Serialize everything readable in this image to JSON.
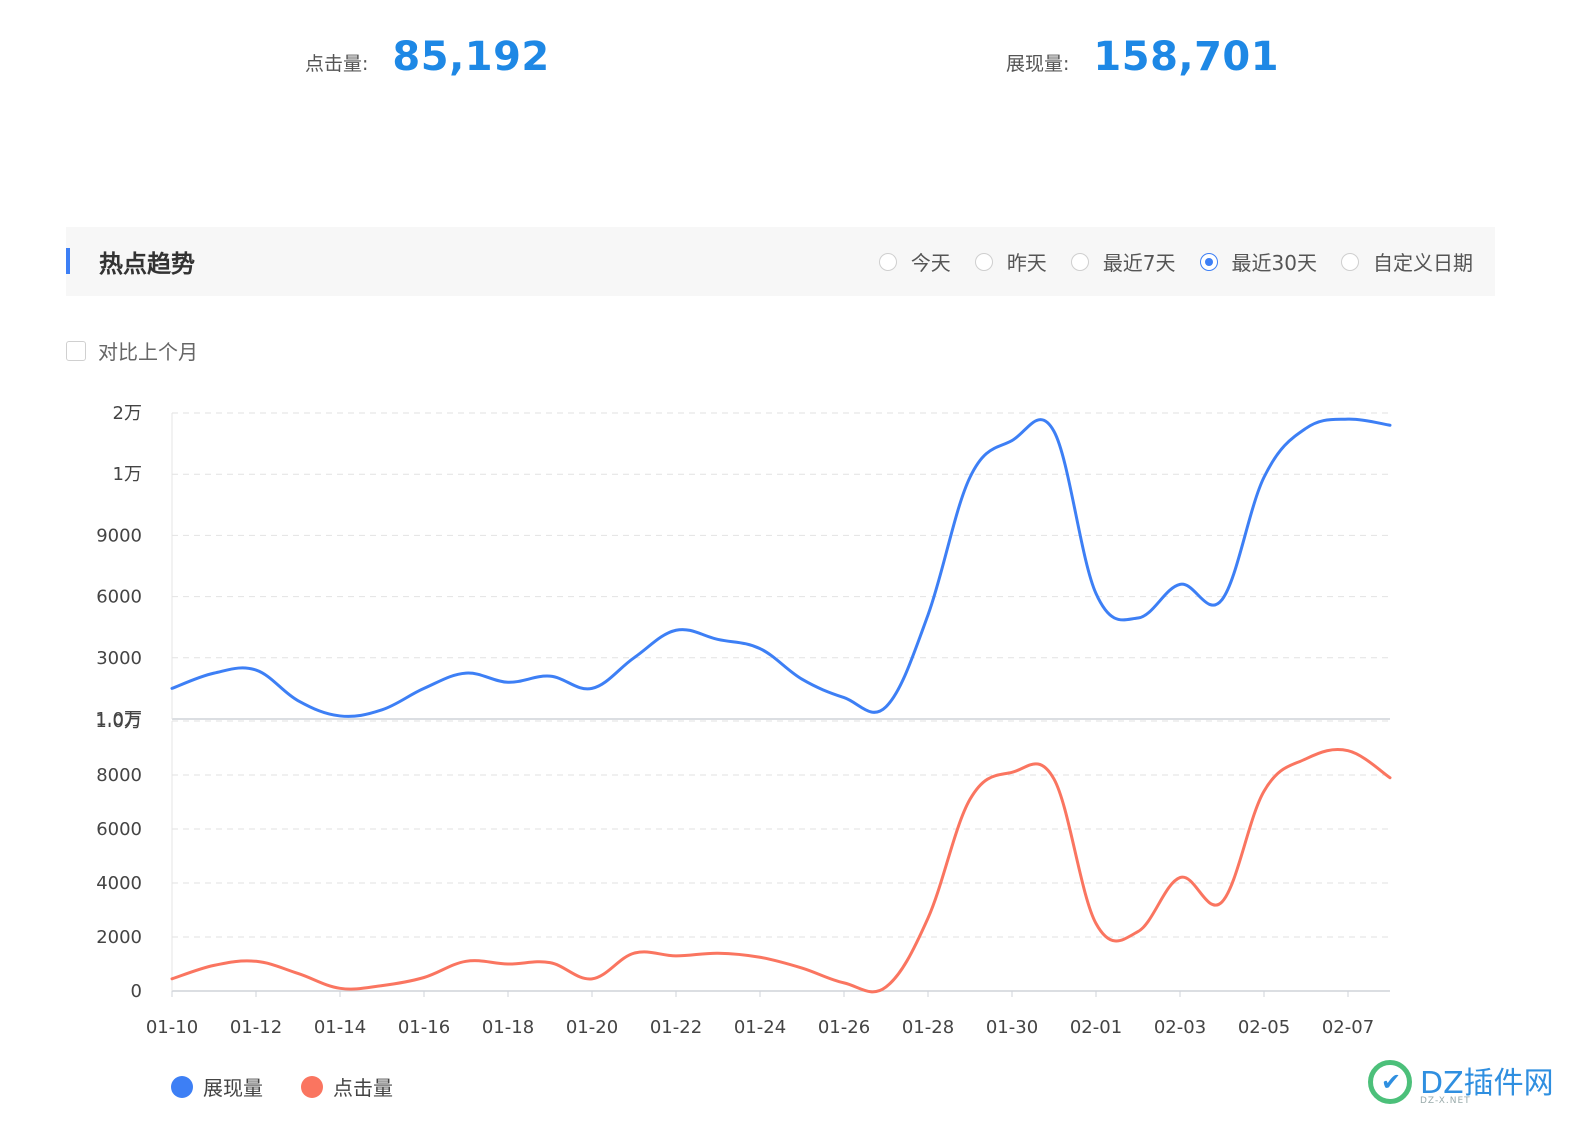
{
  "stats": {
    "clicks_label": "点击量:",
    "clicks_value": "85,192",
    "impressions_label": "展现量:",
    "impressions_value": "158,701"
  },
  "trend": {
    "title": "热点趋势",
    "ranges": [
      {
        "label": "今天",
        "checked": false
      },
      {
        "label": "昨天",
        "checked": false
      },
      {
        "label": "最近7天",
        "checked": false
      },
      {
        "label": "最近30天",
        "checked": true
      },
      {
        "label": "自定义日期",
        "checked": false
      }
    ],
    "compare_label": "对比上个月"
  },
  "colors": {
    "impressions": "#3d7ff5",
    "clicks": "#fa7560",
    "value_text": "#1e88e5"
  },
  "watermark": {
    "text": "DZ插件网",
    "sub": "DZ-X.NET"
  },
  "chart_data": {
    "type": "line",
    "x": [
      "01-10",
      "01-11",
      "01-12",
      "01-13",
      "01-14",
      "01-15",
      "01-16",
      "01-17",
      "01-18",
      "01-19",
      "01-20",
      "01-21",
      "01-22",
      "01-23",
      "01-24",
      "01-25",
      "01-26",
      "01-27",
      "01-28",
      "01-29",
      "01-30",
      "01-31",
      "02-01",
      "02-02",
      "02-03",
      "02-04",
      "02-05",
      "02-06",
      "02-07",
      "02-08"
    ],
    "xticks": [
      "01-10",
      "01-12",
      "01-14",
      "01-16",
      "01-18",
      "01-20",
      "01-22",
      "01-24",
      "01-26",
      "01-28",
      "01-30",
      "02-01",
      "02-03",
      "02-05",
      "02-07"
    ],
    "grid": true,
    "legend_position": "bottom-left",
    "panels": [
      {
        "series": [
          {
            "name": "展现量",
            "values": [
              1000,
              1500,
              1600,
              600,
              100,
              300,
              1000,
              1500,
              1200,
              1400,
              1000,
              2000,
              2900,
              2600,
              2300,
              1300,
              700,
              400,
              3400,
              7900,
              9100,
              9400,
              4100,
              3300,
              4400,
              3900,
              7900,
              9500,
              9800,
              9600
            ]
          }
        ],
        "ylim": [
          0,
          10000
        ],
        "yticks": [
          0,
          3000,
          6000,
          9000,
          12000,
          15000
        ],
        "ytick_labels": [
          "1.0万",
          "3000",
          "6000",
          "9000",
          "1万",
          "2万"
        ]
      },
      {
        "series": [
          {
            "name": "点击量",
            "values": [
              450,
              950,
              1100,
              650,
              100,
              200,
              500,
              1100,
              1000,
              1050,
              450,
              1400,
              1300,
              1400,
              1250,
              850,
              300,
              150,
              2700,
              7100,
              8100,
              7850,
              2500,
              2200,
              4200,
              3300,
              7400,
              8600,
              8900,
              7900
            ]
          }
        ],
        "ylim": [
          0,
          10000
        ],
        "yticks": [
          0,
          2000,
          4000,
          6000,
          8000,
          10000
        ],
        "ytick_labels": [
          "0",
          "2000",
          "4000",
          "6000",
          "8000",
          "1.0万"
        ]
      }
    ]
  }
}
